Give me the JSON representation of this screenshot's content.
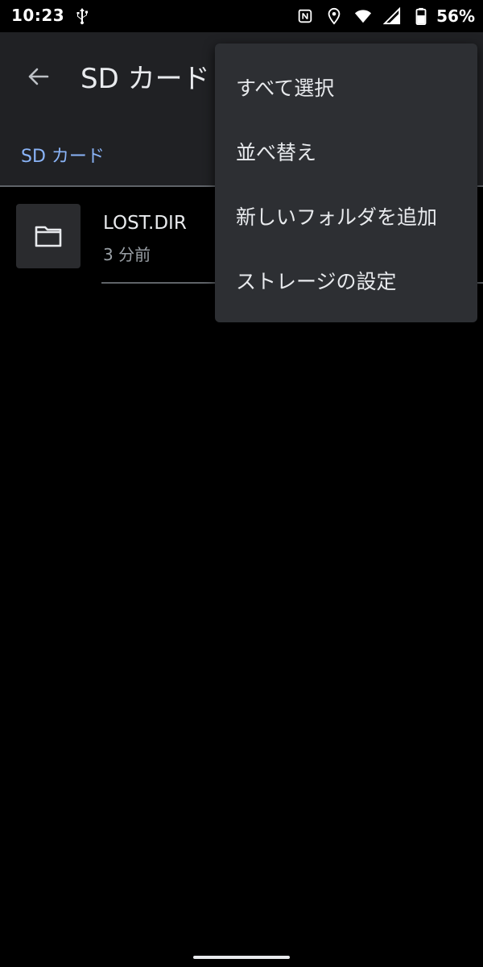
{
  "status_bar": {
    "time": "10:23",
    "battery_percent": "56%",
    "icons": [
      "usb-icon",
      "nfc-icon",
      "location-icon",
      "wifi-icon",
      "signal-icon",
      "battery-icon"
    ]
  },
  "app_bar": {
    "title": "SD カード",
    "back_icon": "arrow-back-icon"
  },
  "breadcrumb": {
    "label": "SD カード"
  },
  "files": [
    {
      "name": "LOST.DIR",
      "meta": "3 分前",
      "icon": "folder-icon"
    }
  ],
  "menu": {
    "items": [
      {
        "label": "すべて選択"
      },
      {
        "label": "並べ替え"
      },
      {
        "label": "新しいフォルダを追加"
      },
      {
        "label": "ストレージの設定"
      }
    ]
  },
  "colors": {
    "background": "#000000",
    "app_bar": "#202124",
    "menu": "#2d2f33",
    "accent": "#8ab4f8",
    "text_primary": "#e8eaed",
    "text_secondary": "#9aa0a6",
    "divider": "#5f6368"
  }
}
